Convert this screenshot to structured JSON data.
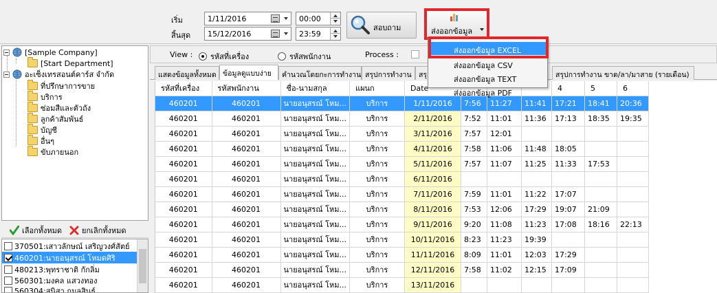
{
  "toolbar": {
    "start_label": "เริ่ม",
    "end_label": "สิ้นสุด",
    "start_date": "1/11/2016",
    "end_date": "15/12/2016",
    "start_time": "00:00",
    "end_time": "23:59",
    "query_label": "สอบถาม",
    "export_label": "ส่งออกข้อมูล"
  },
  "export_menu": {
    "items": [
      "ส่งออกข้อมูล EXCEL",
      "ส่งออกข้อมูล CSV",
      "ส่งออกข้อมูล TEXT",
      "ส่งออกข้อมูล PDF"
    ],
    "highlighted": 0
  },
  "tree": {
    "nodes": [
      {
        "label": "[Sample Company]",
        "icon": "globe-icon",
        "level": 0
      },
      {
        "label": "[Start Department]",
        "icon": "folder-icon",
        "level": 1
      },
      {
        "label": "อะเซ็งเทรสอนต์คาร์ส จำกัด",
        "icon": "globe-icon",
        "level": 0
      },
      {
        "label": "ที่ปรึกษาการขาย",
        "icon": "folder-icon",
        "level": 1
      },
      {
        "label": "บริการ",
        "icon": "folder-icon",
        "level": 1
      },
      {
        "label": "ซ่อมสีและตัวถัง",
        "icon": "folder-icon",
        "level": 1
      },
      {
        "label": "ลูกค้าสัมพันธ์",
        "icon": "folder-icon",
        "level": 1
      },
      {
        "label": "บัญชี",
        "icon": "folder-icon",
        "level": 1
      },
      {
        "label": "อื่นๆ",
        "icon": "folder-icon",
        "level": 1
      },
      {
        "label": "ขับภายนอก",
        "icon": "folder-icon",
        "level": 1
      }
    ]
  },
  "selection": {
    "select_all": "เลือกทั้งหมด",
    "deselect_all": "ยกเลิกทั้งหมด"
  },
  "employees": [
    {
      "label": "370501:เสาวลักษณ์ เสริญวงศ์สัตย์",
      "checked": false,
      "selected": false
    },
    {
      "label": "460201:นายอนุสรณ์ โหมดศิริ",
      "checked": true,
      "selected": true
    },
    {
      "label": "480213:พุทราชาติ กักลิ่ม",
      "checked": false,
      "selected": false
    },
    {
      "label": "560301:มงคล แสวงทอง",
      "checked": false,
      "selected": false
    },
    {
      "label": "560304:สุนิสา กมลสินธุ์",
      "checked": false,
      "selected": false
    }
  ],
  "view": {
    "label": "View :",
    "option_machine": "รหัสที่เครื่อง",
    "option_employee": "รหัสพนักงาน",
    "process_label": "Process :"
  },
  "tabs": [
    "แสดงข้อมูลทั้งหมด",
    "ข้อมูลดูแบบง่าย",
    "คำนวณโดยกะการทำงาน",
    "สรุปการทำงาน",
    "สรุ",
    "สรุปการทำงาน ขาด/ลา/มาสาย (รายเดือน)"
  ],
  "grid": {
    "columns": [
      "รหัสที่เครื่อง",
      "รหัสพนักงาน",
      "ชื่อ-นามสกุล",
      "แผนก",
      "Date",
      "",
      "",
      "",
      "4",
      "5",
      "6"
    ],
    "rows": [
      [
        "460201",
        "460201",
        "นายอนุสรณ์ โหม...",
        "บริการ",
        "1/11/2016",
        "7:56",
        "11:27",
        "11:41",
        "17:21",
        "18:41",
        "20:36"
      ],
      [
        "460201",
        "460201",
        "นายอนุสรณ์ โหม...",
        "บริการ",
        "2/11/2016",
        "7:52",
        "11:01",
        "11:36",
        "17:13",
        "18:35",
        "19:35"
      ],
      [
        "460201",
        "460201",
        "นายอนุสรณ์ โหม...",
        "บริการ",
        "3/11/2016",
        "7:57",
        "12:01",
        "",
        "",
        "",
        ""
      ],
      [
        "460201",
        "460201",
        "นายอนุสรณ์ โหม...",
        "บริการ",
        "4/11/2016",
        "7:58",
        "11:06",
        "11:48",
        "18:05",
        "",
        ""
      ],
      [
        "460201",
        "460201",
        "นายอนุสรณ์ โหม...",
        "บริการ",
        "5/11/2016",
        "7:57",
        "11:07",
        "11:25",
        "11:33",
        "17:53",
        ""
      ],
      [
        "460201",
        "460201",
        "นายอนุสรณ์ โหม...",
        "บริการ",
        "6/11/2016",
        "",
        "",
        "",
        "",
        "",
        ""
      ],
      [
        "460201",
        "460201",
        "นายอนุสรณ์ โหม...",
        "บริการ",
        "7/11/2016",
        "7:59",
        "11:01",
        "11:22",
        "17:07",
        "",
        ""
      ],
      [
        "460201",
        "460201",
        "นายอนุสรณ์ โหม...",
        "บริการ",
        "8/11/2016",
        "7:53",
        "12:06",
        "17:29",
        "19:07",
        "21:09",
        ""
      ],
      [
        "460201",
        "460201",
        "นายอนุสรณ์ โหม...",
        "บริการ",
        "9/11/2016",
        "9:20",
        "11:08",
        "11:23",
        "17:08",
        "18:16",
        "22:13"
      ],
      [
        "460201",
        "460201",
        "นายอนุสรณ์ โหม...",
        "บริการ",
        "10/11/2016",
        "8:23",
        "11:23",
        "19:39",
        "",
        "",
        ""
      ],
      [
        "460201",
        "460201",
        "นายอนุสรณ์ โหม...",
        "บริการ",
        "11/11/2016",
        "8:09",
        "11:01",
        "12:03",
        "17:29",
        "",
        ""
      ],
      [
        "460201",
        "460201",
        "นายอนุสรณ์ โหม...",
        "บริการ",
        "12/11/2016",
        "7:58",
        "11:02",
        "12:15",
        "17:09",
        "",
        ""
      ],
      [
        "460201",
        "460201",
        "นายอนุสรณ์ โหม...",
        "บริการ",
        "13/11/2016",
        "",
        "",
        "",
        "",
        "",
        ""
      ]
    ],
    "selected_row": 0
  },
  "colors": {
    "selection": "#3399ff",
    "date_cell": "#fffbc4",
    "highlight_frame": "#e0282c"
  }
}
